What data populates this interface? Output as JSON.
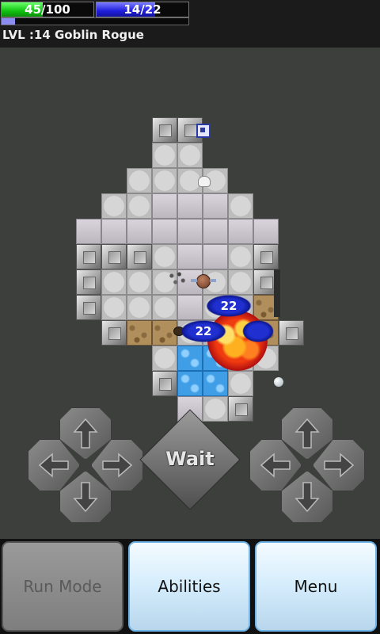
{
  "hud": {
    "hp": {
      "current": "45",
      "max": "100",
      "text": "45/100",
      "fraction": 0.45,
      "color": "#11c311"
    },
    "mp": {
      "current": "14",
      "max": "22",
      "text": "14/22",
      "fraction": 0.64,
      "color": "#1f1fdc"
    },
    "xp": {
      "fraction": 0.07,
      "color": "#8a8cf0"
    },
    "level_text": "LVL :14 Goblin Rogue"
  },
  "map": {
    "damage_numbers": [
      "22",
      "22"
    ]
  },
  "controls": {
    "wait_label": "Wait"
  },
  "action_bar": {
    "run_mode_label": "Run Mode",
    "abilities_label": "Abilities",
    "menu_label": "Menu"
  },
  "icons": {
    "arrows": [
      "up-arrow-icon",
      "down-arrow-icon",
      "left-arrow-icon",
      "right-arrow-icon"
    ]
  }
}
